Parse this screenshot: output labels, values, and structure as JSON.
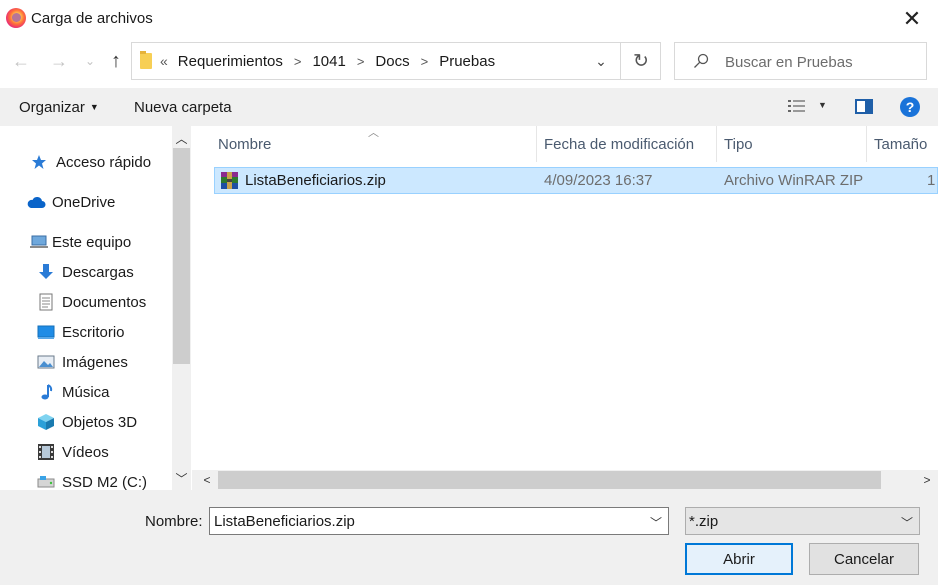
{
  "window": {
    "title": "Carga de archivos",
    "close": "✕"
  },
  "navbar": {
    "back": "←",
    "forward": "→",
    "recent": "⌄",
    "up": "↑",
    "breadcrumb_lead": "«",
    "breadcrumbs": [
      "Requerimientos",
      "1041",
      "Docs",
      "Pruebas"
    ],
    "separator": ">",
    "refresh": "↻",
    "dropdown": "⌄"
  },
  "search": {
    "placeholder": "Buscar en Pruebas"
  },
  "toolbar": {
    "organize_label": "Organizar",
    "new_folder_label": "Nueva carpeta",
    "help_label": "?"
  },
  "sidebar": {
    "items": [
      {
        "label": "Acceso rápido",
        "icon": "star-icon"
      },
      {
        "label": "OneDrive",
        "icon": "cloud-icon"
      },
      {
        "label": "Este equipo",
        "icon": "computer-icon"
      },
      {
        "label": "Descargas",
        "icon": "download-icon"
      },
      {
        "label": "Documentos",
        "icon": "document-icon"
      },
      {
        "label": "Escritorio",
        "icon": "desktop-icon"
      },
      {
        "label": "Imágenes",
        "icon": "pictures-icon"
      },
      {
        "label": "Música",
        "icon": "music-icon"
      },
      {
        "label": "Objetos 3D",
        "icon": "cube-icon"
      },
      {
        "label": "Vídeos",
        "icon": "video-icon"
      },
      {
        "label": "SSD M2 (C:)",
        "icon": "drive-icon"
      }
    ]
  },
  "files": {
    "columns": [
      "Nombre",
      "Fecha de modificación",
      "Tipo",
      "Tamaño"
    ],
    "rows": [
      {
        "name": "ListaBeneficiarios.zip",
        "date": "4/09/2023 16:37",
        "type": "Archivo WinRAR ZIP",
        "size": "1"
      }
    ]
  },
  "bottom": {
    "filename_label": "Nombre:",
    "filename_value": "ListaBeneficiarios.zip",
    "filter_value": "*.zip",
    "open_label": "Abrir",
    "cancel_label": "Cancelar"
  },
  "colors": {
    "accent": "#0078d7",
    "selection": "#cce8ff",
    "selection_border": "#99d1ff"
  }
}
